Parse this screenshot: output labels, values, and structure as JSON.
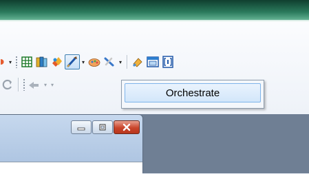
{
  "window": {
    "accent_title_color": "#2b7a5c"
  },
  "toolbar_row1": {
    "icons": [
      "dot-icon",
      "grid-icon",
      "books-icon",
      "layers-icon",
      "orchestra-icon",
      "palette-icon",
      "tools-icon",
      "brush-icon",
      "window-icon",
      "bracket-icon"
    ]
  },
  "toolbar_row2": {
    "icons": [
      "refresh-icon",
      "arrow-icon"
    ]
  },
  "dropdown_menu": {
    "items": [
      {
        "label": "Orchestrate"
      }
    ]
  },
  "child_window": {
    "caption_buttons": [
      "minimize",
      "restore",
      "close"
    ]
  }
}
